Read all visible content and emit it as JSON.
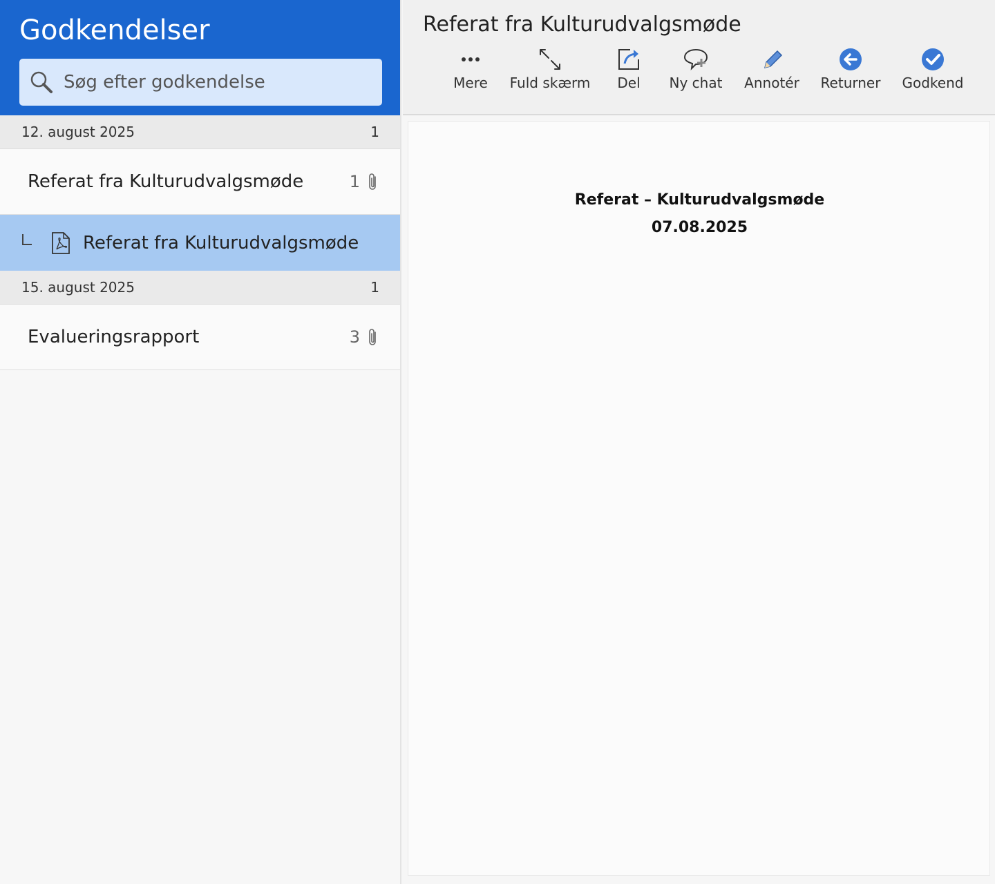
{
  "sidebar": {
    "title": "Godkendelser",
    "search": {
      "placeholder": "Søg efter godkendelse"
    },
    "groups": [
      {
        "date": "12. august 2025",
        "count": "1",
        "items": [
          {
            "title": "Referat fra Kulturudvalgsmøde",
            "attachments": "1",
            "icon": "paperclip-icon"
          }
        ],
        "sub_items": [
          {
            "title": "Referat fra Kulturudvalgsmøde",
            "icon": "pdf-file-icon",
            "selected": true
          }
        ]
      },
      {
        "date": "15. august 2025",
        "count": "1",
        "items": [
          {
            "title": "Evalueringsrapport",
            "attachments": "3",
            "icon": "paperclip-icon"
          }
        ]
      }
    ]
  },
  "main": {
    "title": "Referat fra Kulturudvalgsmøde",
    "toolbar": [
      {
        "label": "Mere",
        "icon": "more-icon"
      },
      {
        "label": "Fuld skærm",
        "icon": "fullscreen-icon"
      },
      {
        "label": "Del",
        "icon": "share-icon"
      },
      {
        "label": "Ny chat",
        "icon": "new-chat-icon"
      },
      {
        "label": "Annotér",
        "icon": "pencil-icon"
      },
      {
        "label": "Returner",
        "icon": "return-icon"
      },
      {
        "label": "Godkend",
        "icon": "approve-icon"
      }
    ],
    "document": {
      "heading": "Referat – Kulturudvalgsmøde",
      "date": "07.08.2025"
    }
  },
  "colors": {
    "brand_blue": "#1a66cf",
    "selected_row": "#a6c9f2",
    "search_bg": "#d9e8fc",
    "icon_blue": "#3a78d4"
  }
}
